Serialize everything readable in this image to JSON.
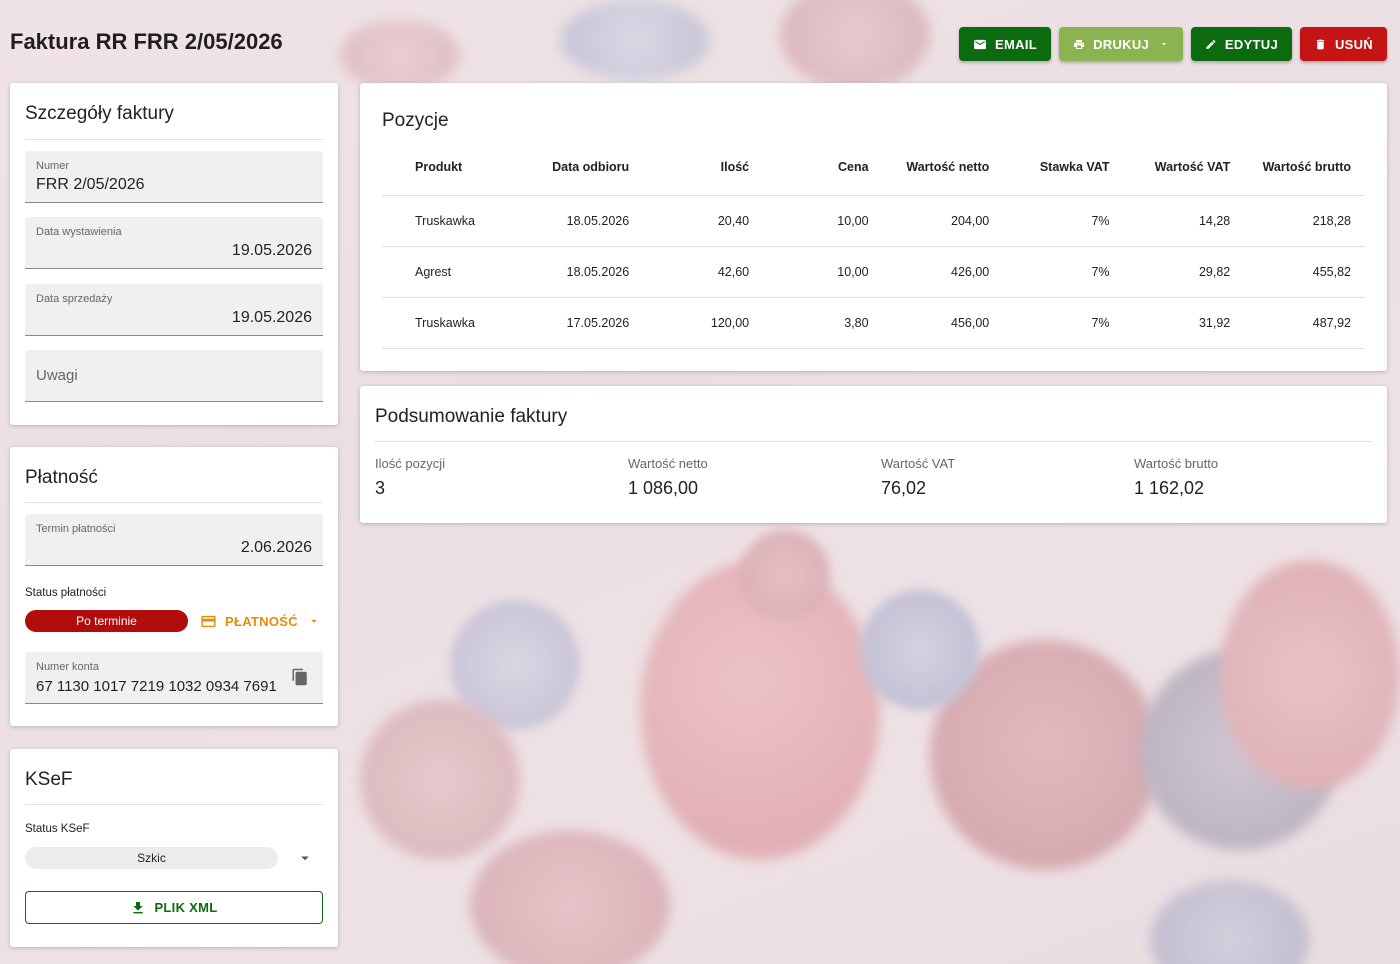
{
  "page": {
    "title": "Faktura RR FRR 2/05/2026"
  },
  "toolbar": {
    "email_label": "EMAIL",
    "print_label": "DRUKUJ",
    "edit_label": "EDYTUJ",
    "delete_label": "USUŃ",
    "colors": {
      "email": "#0b6b0e",
      "print": "#8bb34f",
      "edit": "#0b6b0e",
      "delete": "#c41414"
    }
  },
  "details": {
    "title": "Szczegóły faktury",
    "numer_label": "Numer",
    "numer_value": "FRR 2/05/2026",
    "data_wystawienia_label": "Data wystawienia",
    "data_wystawienia_value": "19.05.2026",
    "data_sprzedazy_label": "Data sprzedaży",
    "data_sprzedazy_value": "19.05.2026",
    "uwagi_placeholder": "Uwagi"
  },
  "payment": {
    "title": "Płatność",
    "termin_label": "Termin płatności",
    "termin_value": "2.06.2026",
    "status_label": "Status płatności",
    "status_value": "Po terminie",
    "platnosc_button": "PŁATNOŚĆ",
    "konto_label": "Numer konta",
    "konto_value": "67 1130 1017 7219 1032 0934 7691"
  },
  "ksef": {
    "title": "KSeF",
    "status_label": "Status KSeF",
    "status_value": "Szkic",
    "xml_button": "PLIK XML"
  },
  "positions": {
    "title": "Pozycje",
    "columns": [
      "Produkt",
      "Data odbioru",
      "Ilość",
      "Cena",
      "Wartość netto",
      "Stawka VAT",
      "Wartość VAT",
      "Wartość brutto"
    ],
    "rows": [
      [
        "Truskawka",
        "18.05.2026",
        "20,40",
        "10,00",
        "204,00",
        "7%",
        "14,28",
        "218,28"
      ],
      [
        "Agrest",
        "18.05.2026",
        "42,60",
        "10,00",
        "426,00",
        "7%",
        "29,82",
        "455,82"
      ],
      [
        "Truskawka",
        "17.05.2026",
        "120,00",
        "3,80",
        "456,00",
        "7%",
        "31,92",
        "487,92"
      ]
    ]
  },
  "summary": {
    "title": "Podsumowanie faktury",
    "items": [
      {
        "label": "Ilość pozycji",
        "value": "3"
      },
      {
        "label": "Wartość netto",
        "value": "1 086,00"
      },
      {
        "label": "Wartość VAT",
        "value": "76,02"
      },
      {
        "label": "Wartość brutto",
        "value": "1 162,02"
      }
    ]
  }
}
